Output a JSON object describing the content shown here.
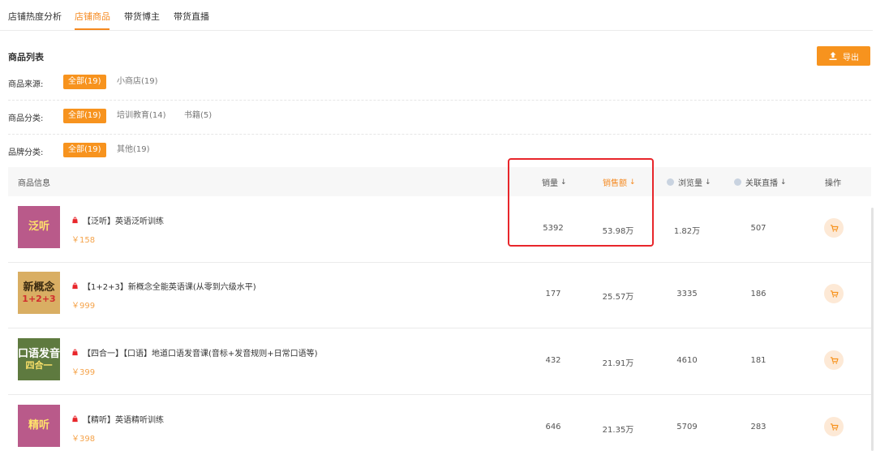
{
  "tabs": [
    {
      "label": "店铺热度分析",
      "active": false
    },
    {
      "label": "店铺商品",
      "active": true
    },
    {
      "label": "带货博主",
      "active": false
    },
    {
      "label": "带货直播",
      "active": false
    }
  ],
  "section_title": "商品列表",
  "export_label": "导出",
  "filters": [
    {
      "label": "商品来源:",
      "options": [
        "全部(19)",
        "小商店(19)"
      ]
    },
    {
      "label": "商品分类:",
      "options": [
        "全部(19)",
        "培训教育(14)",
        "书籍(5)"
      ]
    },
    {
      "label": "品牌分类:",
      "options": [
        "全部(19)",
        "其他(19)"
      ]
    }
  ],
  "columns": {
    "info": "商品信息",
    "sales": "销量",
    "revenue": "销售额",
    "views": "浏览量",
    "live": "关联直播",
    "action": "操作",
    "sort_arrow": "↓"
  },
  "products": [
    {
      "thumb_line1": "泛听",
      "thumb_line2": "",
      "thumb_bg": "#b95a8a",
      "thumb_color": "#ffe36b",
      "title": "【泛听】英语泛听训练",
      "price": "￥158",
      "sales": "5392",
      "revenue": "53.98万",
      "views": "1.82万",
      "live": "507"
    },
    {
      "thumb_line1": "新概念",
      "thumb_line2": "1+2+3",
      "thumb_bg": "#d9ae63",
      "thumb_color": "#3a2a10",
      "thumb_sub_color": "#d22e2e",
      "title": "【1+2+3】新概念全能英语课(从零到六级水平)",
      "price": "￥999",
      "sales": "177",
      "revenue": "25.57万",
      "views": "3335",
      "live": "186"
    },
    {
      "thumb_line1": "口语发音",
      "thumb_line2": "四合一",
      "thumb_bg": "#5e7a3f",
      "thumb_color": "#ffffff",
      "thumb_sub_color": "#ffe36b",
      "title": "【四合一】【口语】地道口语发音课(音标+发音规则+日常口语等)",
      "price": "￥399",
      "sales": "432",
      "revenue": "21.91万",
      "views": "4610",
      "live": "181"
    },
    {
      "thumb_line1": "精听",
      "thumb_line2": "",
      "thumb_bg": "#b95a8a",
      "thumb_color": "#ffe36b",
      "title": "【精听】英语精听训练",
      "price": "￥398",
      "sales": "646",
      "revenue": "21.35万",
      "views": "5709",
      "live": "283"
    }
  ],
  "colors": {
    "accent": "#f7931e",
    "highlight_box": "#e8262b"
  }
}
